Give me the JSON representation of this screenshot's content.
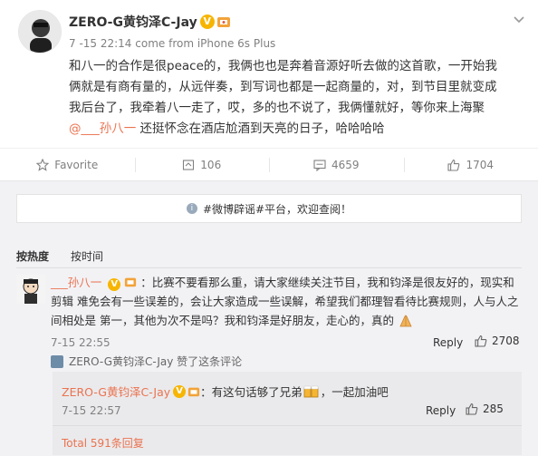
{
  "post": {
    "author": "ZERO-G黄钧泽C-Jay",
    "timestamp": "7 -15 22:14",
    "source": "come from iPhone 6s Plus",
    "text_line1": "和八一的合作是很peace的，我俩也也是奔着音源好听去做的这首歌，一开始我",
    "text_line2": "俩就是有商有量的，从远伴奏，到写词也都是一起商量的，对，到节目里就变成",
    "text_line3": "我后台了，我牵着八一走了，哎，多的也不说了，我俩懂就好，等你来上海聚",
    "mention": "@___孙八一",
    "text_line4_rest": " 还挺怀念在酒店尬酒到天亮的日子，哈哈哈哈"
  },
  "actions": {
    "favorite": "Favorite",
    "repost_count": "106",
    "comment_count": "4659",
    "like_count": "1704"
  },
  "tip": {
    "text": "#微博辟谣#平台，欢迎查阅！"
  },
  "sort": {
    "by_hot": "按热度",
    "by_time": "按时间"
  },
  "comment": {
    "user": "___孙八一",
    "text_part1": "：比赛不要看那么重，请大家继续关注节目，我和钧泽是很友好的，现实和剪辑",
    "text_part2": "难免会有一些误差的，会让大家造成一些误解，希望我们都理智看待比赛规则，人与人之间相处是",
    "text_part3": "第一，其他为次不是吗？我和钧泽是好朋友，走心的，真的",
    "time": "7-15 22:55",
    "reply_label": "Reply",
    "likes": "2708",
    "liked_by": "ZERO-G黄钧泽C-Jay 赞了这条评论"
  },
  "subreply": {
    "user": "ZERO-G黄钧泽C-Jay",
    "text_a": "：有这句话够了兄弟",
    "text_b": "，一起加油吧",
    "time": "7-15 22:57",
    "reply_label": "Reply",
    "likes": "285",
    "total": "Total 591条回复"
  },
  "colors": {
    "accent": "#eb7350",
    "muted": "#808080",
    "panel": "#f2f2f5"
  },
  "icons": [
    "star-icon",
    "repost-icon",
    "comment-icon",
    "thumbs-up-icon",
    "chevron-down-icon",
    "verified-badge-icon",
    "medal-icon"
  ]
}
